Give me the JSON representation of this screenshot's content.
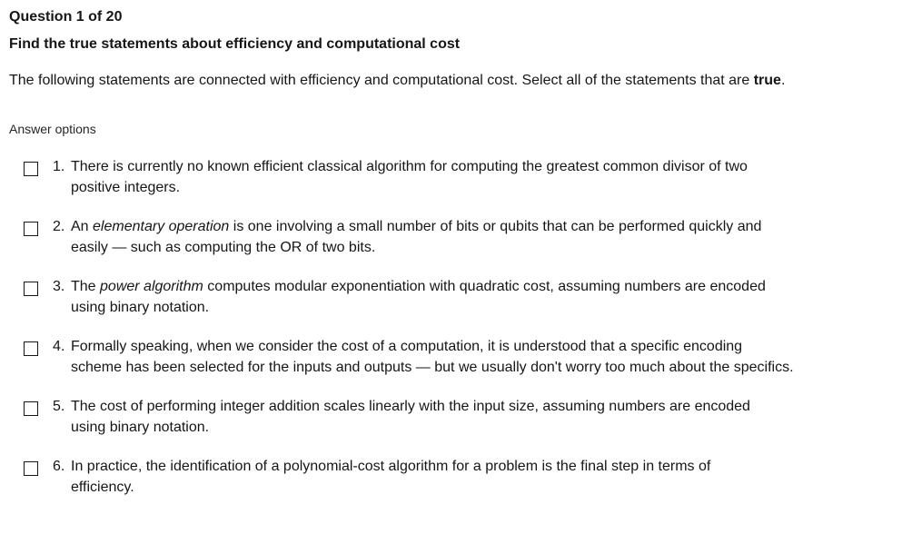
{
  "question": {
    "counter": "Question 1 of 20",
    "title": "Find the true statements about efficiency and computational cost",
    "intro_before": "The following statements are connected with efficiency and computational cost. Select all of the statements that are ",
    "intro_bold": "true",
    "intro_after": "."
  },
  "answers": {
    "heading": "Answer options",
    "options": [
      {
        "number": "1.",
        "line1": "There is currently no known efficient classical algorithm for computing the greatest common divisor of two",
        "line2": "positive integers.",
        "checked": false
      },
      {
        "number": "2.",
        "line1_pre": "An ",
        "line1_em": "elementary operation",
        "line1_post": " is one involving a small number of bits or qubits that can be performed quickly and",
        "line2": "easily — such as computing the OR of two bits.",
        "checked": false
      },
      {
        "number": "3.",
        "line1_pre": "The ",
        "line1_em": "power algorithm",
        "line1_post": " computes modular exponentiation with quadratic cost, assuming numbers are encoded",
        "line2": "using binary notation.",
        "checked": false
      },
      {
        "number": "4.",
        "line1": "Formally speaking, when we consider the cost of a computation, it is understood that a specific encoding",
        "line2": "scheme has been selected for the inputs and outputs — but we usually don't worry too much about the specifics.",
        "checked": false
      },
      {
        "number": "5.",
        "line1": "The cost of performing integer addition scales linearly with the input size, assuming numbers are encoded",
        "line2": "using binary notation.",
        "checked": false
      },
      {
        "number": "6.",
        "line1": "In practice, the identification of a polynomial-cost algorithm for a problem is the final step in terms of",
        "line2": "efficiency.",
        "checked": false
      }
    ]
  }
}
